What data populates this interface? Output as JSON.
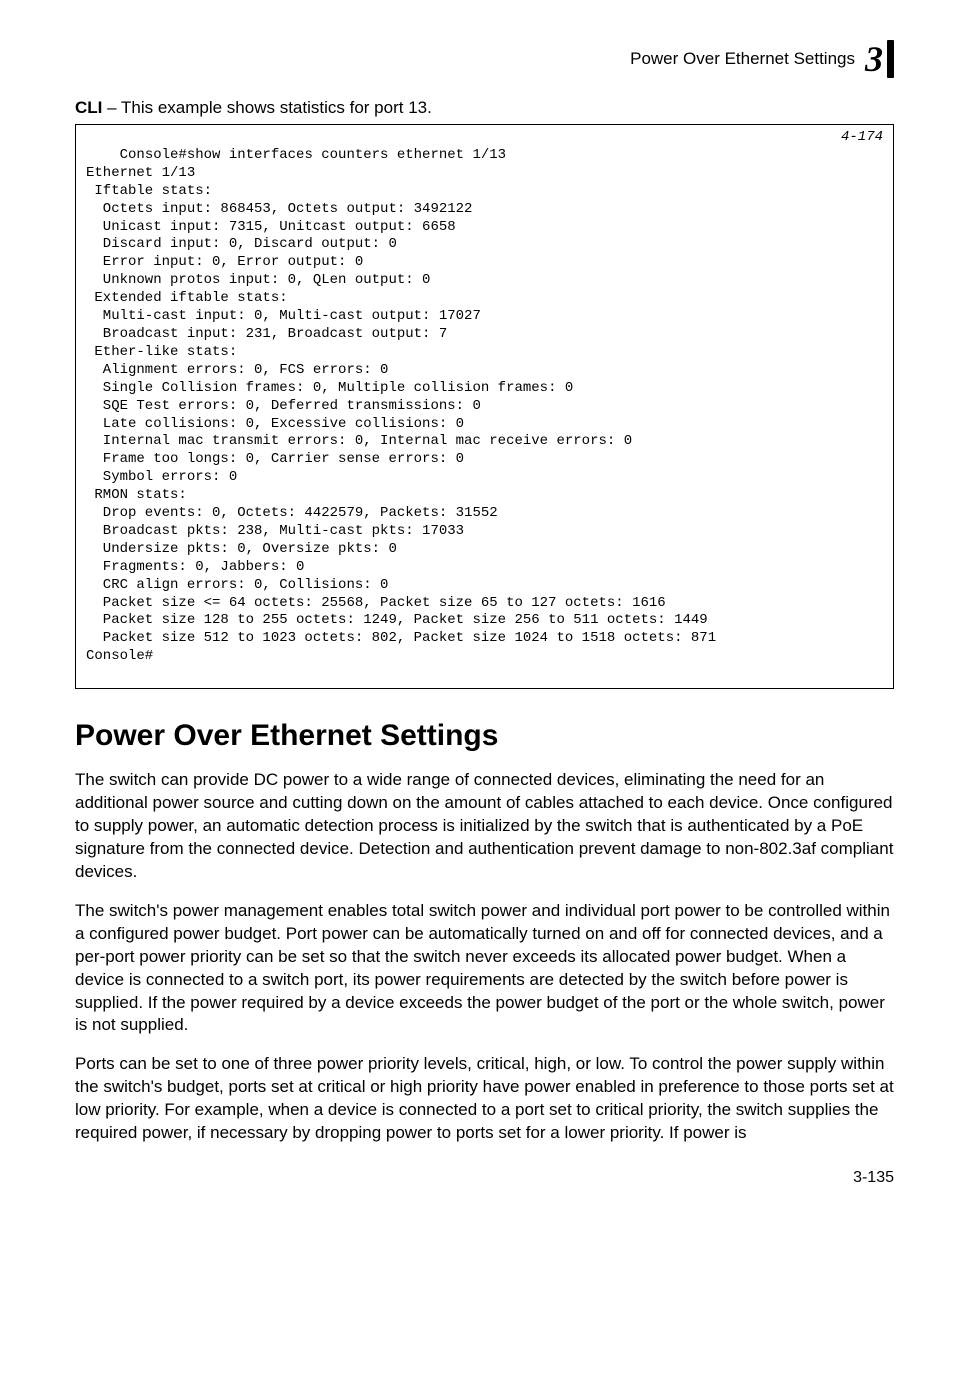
{
  "header": {
    "running_title": "Power Over Ethernet Settings",
    "chapter_number": "3"
  },
  "cli_intro_bold": "CLI",
  "cli_intro_rest": " – This example shows statistics for port 13.",
  "code": {
    "ref": "4-174",
    "text": "Console#show interfaces counters ethernet 1/13\nEthernet 1/13\n Iftable stats:\n  Octets input: 868453, Octets output: 3492122\n  Unicast input: 7315, Unitcast output: 6658\n  Discard input: 0, Discard output: 0\n  Error input: 0, Error output: 0\n  Unknown protos input: 0, QLen output: 0\n Extended iftable stats:\n  Multi-cast input: 0, Multi-cast output: 17027\n  Broadcast input: 231, Broadcast output: 7\n Ether-like stats:\n  Alignment errors: 0, FCS errors: 0\n  Single Collision frames: 0, Multiple collision frames: 0\n  SQE Test errors: 0, Deferred transmissions: 0\n  Late collisions: 0, Excessive collisions: 0\n  Internal mac transmit errors: 0, Internal mac receive errors: 0\n  Frame too longs: 0, Carrier sense errors: 0\n  Symbol errors: 0\n RMON stats:\n  Drop events: 0, Octets: 4422579, Packets: 31552\n  Broadcast pkts: 238, Multi-cast pkts: 17033\n  Undersize pkts: 0, Oversize pkts: 0\n  Fragments: 0, Jabbers: 0\n  CRC align errors: 0, Collisions: 0\n  Packet size <= 64 octets: 25568, Packet size 65 to 127 octets: 1616\n  Packet size 128 to 255 octets: 1249, Packet size 256 to 511 octets: 1449\n  Packet size 512 to 1023 octets: 802, Packet size 1024 to 1518 octets: 871\nConsole#"
  },
  "section_title": "Power Over Ethernet Settings",
  "paragraphs": {
    "p1": "The switch can provide DC power to a wide range of connected devices, eliminating the need for an additional power source and cutting down on the amount of cables attached to each device. Once configured to supply power, an automatic detection process is initialized by the switch that is authenticated by a PoE signature from the connected device. Detection and authentication prevent damage to non-802.3af compliant devices.",
    "p2": "The switch's power management enables total switch power and individual port power to be controlled within a configured power budget. Port power can be automatically turned on and off for connected devices, and a per-port power priority can be set so that the switch never exceeds its allocated power budget. When a device is connected to a switch port, its power requirements are detected by the switch before power is supplied. If the power required by a device exceeds the power budget of the port or the whole switch, power is not supplied.",
    "p3": "Ports can be set to one of three power priority levels, critical, high, or low. To control the power supply within the switch's budget, ports set at critical or high priority have power enabled in preference to those ports set at low priority. For example, when a device is connected to a port set to critical priority, the switch supplies the required power, if necessary by dropping power to ports set for a lower priority. If power is"
  },
  "page_number": "3-135"
}
